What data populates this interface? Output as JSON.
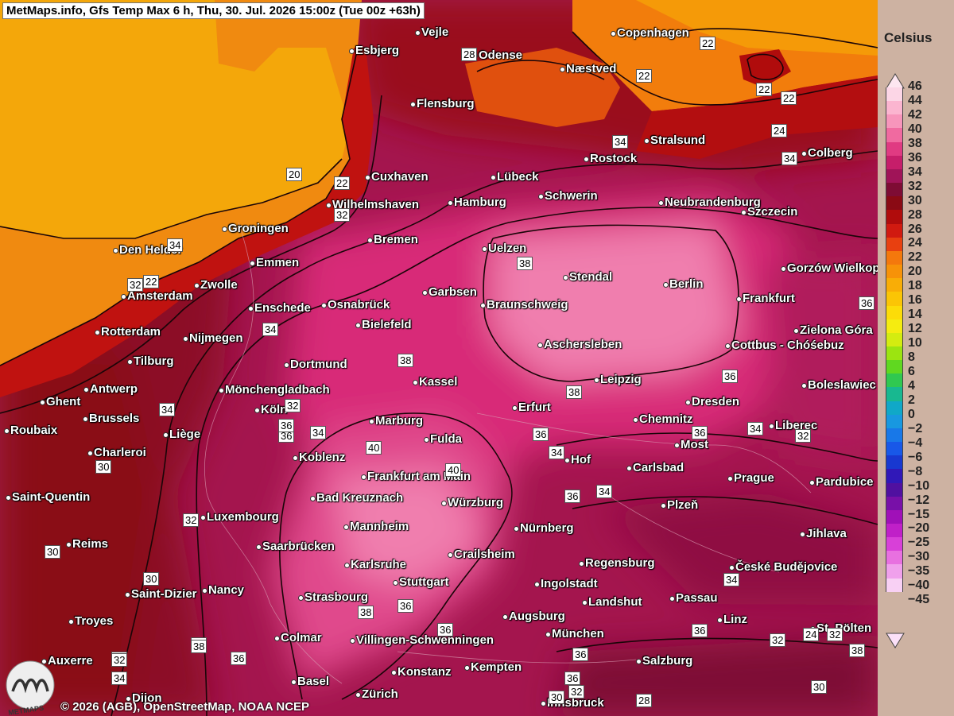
{
  "header": {
    "title": "MetMaps.info, Gfs Temp Max 6 h, Thu, 30. Jul. 2026 15:00z (Tue 00z +63h)"
  },
  "footer": {
    "copyright": "© 2026 (AGB), OpenStreetMap, NOAA NCEP",
    "logo_text": "METMAPS"
  },
  "legend": {
    "unit": "Celsius",
    "labels": [
      "46",
      "44",
      "42",
      "40",
      "38",
      "36",
      "34",
      "32",
      "30",
      "28",
      "26",
      "24",
      "22",
      "20",
      "18",
      "16",
      "14",
      "12",
      "10",
      "8",
      "6",
      "4",
      "2",
      "0",
      "−2",
      "−4",
      "−6",
      "−8",
      "−10",
      "−12",
      "−15",
      "−20",
      "−25",
      "−30",
      "−35",
      "−40",
      "−45"
    ],
    "colors": [
      "#fcd6e6",
      "#fbb5d0",
      "#f795bb",
      "#f06aa0",
      "#e03a82",
      "#c61e6a",
      "#a01458",
      "#7e0c34",
      "#8a0a14",
      "#b00c0c",
      "#d11a10",
      "#e84010",
      "#f4780c",
      "#f79208",
      "#f9ad06",
      "#fbc505",
      "#fcdc08",
      "#f5ec10",
      "#d4ec10",
      "#9ce410",
      "#60d820",
      "#30c850",
      "#18b890",
      "#10a8c8",
      "#1898e0",
      "#1878e8",
      "#1858e8",
      "#1838d0",
      "#3018b8",
      "#5010a0",
      "#7810a8",
      "#a010b8",
      "#c020c8",
      "#d840d8",
      "#e870e0",
      "#f0a0ec",
      "#f8d0f4"
    ]
  },
  "cities": [
    {
      "name": "Vejle"
    },
    {
      "name": "Esbjerg"
    },
    {
      "name": "Odense"
    },
    {
      "name": "Copenhagen"
    },
    {
      "name": "Næstved"
    },
    {
      "name": "Flensburg"
    },
    {
      "name": "Stralsund"
    },
    {
      "name": "Rostock"
    },
    {
      "name": "Colberg"
    },
    {
      "name": "Cuxhaven"
    },
    {
      "name": "Lübeck"
    },
    {
      "name": "Wilhelmshaven"
    },
    {
      "name": "Hamburg"
    },
    {
      "name": "Schwerin"
    },
    {
      "name": "Neubrandenburg"
    },
    {
      "name": "Szczecin"
    },
    {
      "name": "Groningen"
    },
    {
      "name": "Bremen"
    },
    {
      "name": "Den Helder"
    },
    {
      "name": "Uelzen"
    },
    {
      "name": "Emmen"
    },
    {
      "name": "Gorzów Wielkopolski"
    },
    {
      "name": "Zwolle"
    },
    {
      "name": "Stendal"
    },
    {
      "name": "Berlin"
    },
    {
      "name": "Amsterdam"
    },
    {
      "name": "Garbsen"
    },
    {
      "name": "Frankfurt"
    },
    {
      "name": "Enschede"
    },
    {
      "name": "Osnabrück"
    },
    {
      "name": "Braunschweig"
    },
    {
      "name": "Bielefeld"
    },
    {
      "name": "Rotterdam"
    },
    {
      "name": "Nijmegen"
    },
    {
      "name": "Zielona Góra"
    },
    {
      "name": "Aschersleben"
    },
    {
      "name": "Cottbus - Chóśebuz"
    },
    {
      "name": "Tilburg"
    },
    {
      "name": "Dortmund"
    },
    {
      "name": "Kassel"
    },
    {
      "name": "Leipzig"
    },
    {
      "name": "Antwerp"
    },
    {
      "name": "Mönchengladbach"
    },
    {
      "name": "Boleslawiec"
    },
    {
      "name": "Ghent"
    },
    {
      "name": "Dresden"
    },
    {
      "name": "Köln"
    },
    {
      "name": "Erfurt"
    },
    {
      "name": "Brussels"
    },
    {
      "name": "Marburg"
    },
    {
      "name": "Chemnitz"
    },
    {
      "name": "Liberec"
    },
    {
      "name": "Roubaix"
    },
    {
      "name": "Liège"
    },
    {
      "name": "Fulda"
    },
    {
      "name": "Most"
    },
    {
      "name": "Charleroi"
    },
    {
      "name": "Koblenz"
    },
    {
      "name": "Hof"
    },
    {
      "name": "Carlsbad"
    },
    {
      "name": "Frankfurt am Main"
    },
    {
      "name": "Prague"
    },
    {
      "name": "Pardubice"
    },
    {
      "name": "Saint-Quentin"
    },
    {
      "name": "Bad Kreuznach"
    },
    {
      "name": "Würzburg"
    },
    {
      "name": "Plzeň"
    },
    {
      "name": "Luxembourg"
    },
    {
      "name": "Mannheim"
    },
    {
      "name": "Nürnberg"
    },
    {
      "name": "Jihlava"
    },
    {
      "name": "Reims"
    },
    {
      "name": "Saarbrücken"
    },
    {
      "name": "Crailsheim"
    },
    {
      "name": "Karlsruhe"
    },
    {
      "name": "Regensburg"
    },
    {
      "name": "České Budějovice"
    },
    {
      "name": "Stuttgart"
    },
    {
      "name": "Ingolstadt"
    },
    {
      "name": "Nancy"
    },
    {
      "name": "Saint-Dizier"
    },
    {
      "name": "Strasbourg"
    },
    {
      "name": "Landshut"
    },
    {
      "name": "Passau"
    },
    {
      "name": "Troyes"
    },
    {
      "name": "Augsburg"
    },
    {
      "name": "Linz"
    },
    {
      "name": "St. Pölten"
    },
    {
      "name": "Colmar"
    },
    {
      "name": "Villingen-Schwenningen"
    },
    {
      "name": "München"
    },
    {
      "name": "Auxerre"
    },
    {
      "name": "Konstanz"
    },
    {
      "name": "Kempten"
    },
    {
      "name": "Salzburg"
    },
    {
      "name": "Basel"
    },
    {
      "name": "Zürich"
    },
    {
      "name": "Innsbruck"
    },
    {
      "name": "Dijon"
    }
  ],
  "isotherm_labels": [
    "22",
    "22",
    "22",
    "22",
    "20",
    "22",
    "32",
    "34",
    "34",
    "24",
    "22",
    "34",
    "32",
    "38",
    "34",
    "38",
    "38",
    "36",
    "32",
    "34",
    "36",
    "40",
    "40",
    "36",
    "36",
    "34",
    "34",
    "32",
    "36",
    "38",
    "36",
    "36",
    "38",
    "36",
    "36",
    "34",
    "32",
    "34",
    "30",
    "30",
    "30",
    "32",
    "34",
    "36",
    "36",
    "30",
    "32",
    "28",
    "30",
    "28",
    "34",
    "36",
    "32",
    "32",
    "38",
    "24",
    "38",
    "36",
    "34"
  ]
}
